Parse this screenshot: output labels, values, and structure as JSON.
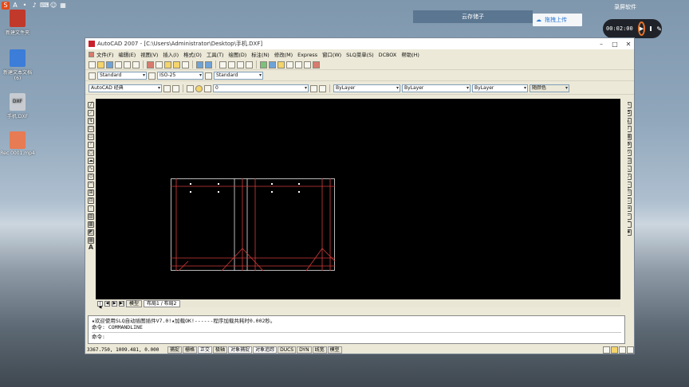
{
  "desktop": {
    "icons": [
      {
        "label": "新建文件夹",
        "color": "#c0392b"
      },
      {
        "label": "新建文本文档 (6)",
        "color": "#3b7dd8"
      },
      {
        "label": "手机.DXF",
        "color": "#c8ccd2"
      },
      {
        "label": "Rec 0001.mp4",
        "color": "#e77b54"
      }
    ],
    "ime_logo": "S"
  },
  "overlays": {
    "tooltip_text": "云存储子",
    "cloud_upload_label": "拖拽上传",
    "recorder_top_text": "录屏软件",
    "recorder_time": "00:02:00"
  },
  "window": {
    "title": "AutoCAD 2007 - [C:\\Users\\Administrator\\Desktop\\手机.DXF]",
    "menu": [
      "文件(F)",
      "编辑(E)",
      "视图(V)",
      "插入(I)",
      "格式(O)",
      "工具(T)",
      "绘图(D)",
      "标注(N)",
      "修改(M)",
      "Express",
      "窗口(W)",
      "SLQ菜单(S)",
      "DCBOX",
      "帮助(H)"
    ],
    "style_toolbar": {
      "text_style": "Standard",
      "dim_style": "ISO-25",
      "table_style": "Standard"
    },
    "layer_toolbar": {
      "workspace": "AutoCAD 经典",
      "layer": "0"
    },
    "props_toolbar": {
      "color": "ByLayer",
      "linetype": "ByLayer",
      "lineweight": "ByLayer",
      "plotstyle": "随颜色"
    },
    "tabs": [
      "模型",
      "布局1 / 布局2"
    ],
    "command_lines": [
      "★欢迎使用SLQ自动插图插件V7.0!★加载OK!------程序加载共耗时0.002秒。",
      "命令:  COMMANDLINE"
    ],
    "command_prompt": "命令:",
    "status": {
      "coords": "3367.750, 1009.481, 0.000",
      "buttons": [
        "捕捉",
        "栅格",
        "正交",
        "极轴",
        "对象捕捉",
        "对象追踪",
        "DUCS",
        "DYN",
        "线宽",
        "模型"
      ]
    }
  }
}
